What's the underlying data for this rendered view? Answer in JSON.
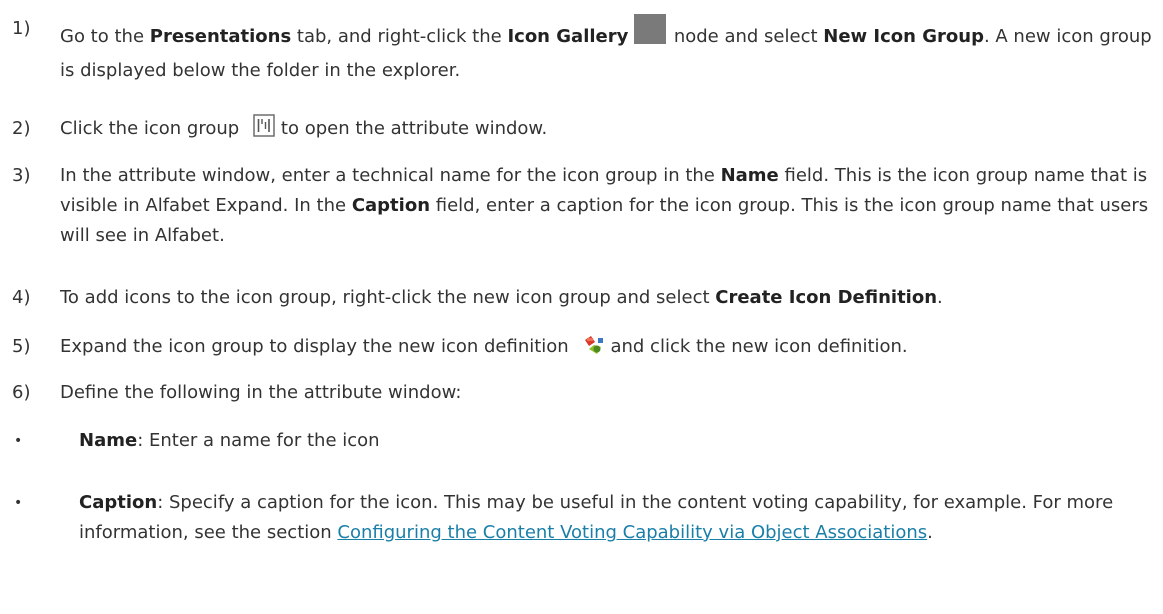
{
  "steps": [
    {
      "num": "1)",
      "parts": {
        "a": "Go to the ",
        "b": "Presentations",
        "c": " tab, and right-click the ",
        "d": "Icon Gallery",
        "e": " node and select ",
        "f": "New Icon Group",
        "g": ". A new icon group is displayed below the folder in the explorer."
      }
    },
    {
      "num": "2)",
      "parts": {
        "a": "Click the icon group",
        "b": " to open the attribute window."
      }
    },
    {
      "num": "3)",
      "parts": {
        "a": "In the attribute window, enter a technical name for the icon group in the ",
        "b": "Name",
        "c": " field. This is the icon group name that is visible in Alfabet Expand. In the ",
        "d": "Caption",
        "e": " field, enter a caption for the icon group. This is the icon group name that users will see in Alfabet."
      }
    },
    {
      "num": "4)",
      "parts": {
        "a": "To add icons to the icon group, right-click the new icon group and select ",
        "b": "Create Icon Definition",
        "c": "."
      }
    },
    {
      "num": "5)",
      "parts": {
        "a": "Expand the icon group to display the new icon definition",
        "b": " and click the new icon definition."
      }
    },
    {
      "num": "6)",
      "parts": {
        "a": "Define the following in the attribute window:"
      }
    }
  ],
  "bullets": [
    {
      "dot": "•",
      "label": "Name",
      "text": ": Enter a name for the icon"
    },
    {
      "dot": "•",
      "label": "Caption",
      "text": ": Specify a caption for the icon. This may be useful in the content voting capability, for example. For more information, see the section ",
      "link": "Configuring the Content Voting Capability via Object Associations",
      "end": "."
    }
  ],
  "icons": {
    "folder": "folder-icon",
    "icon_group": "icon-group-icon",
    "icon_definition": "icon-definition-icon"
  },
  "colors": {
    "text": "#333333",
    "link": "#1a7fa8"
  }
}
